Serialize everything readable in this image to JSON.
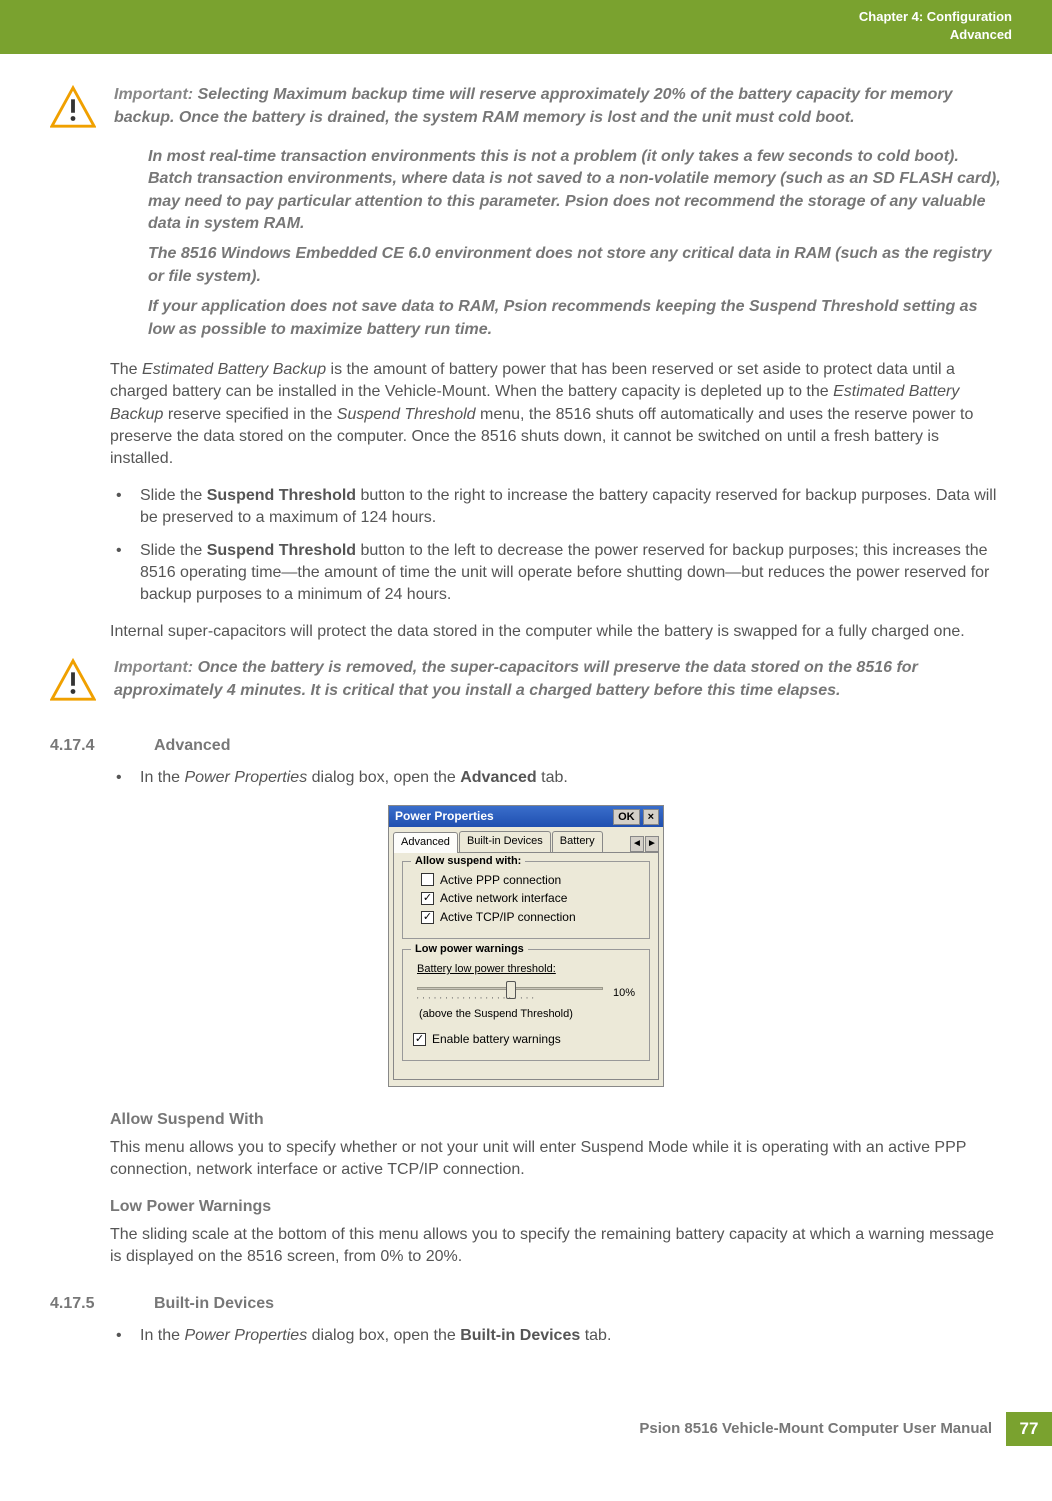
{
  "header": {
    "line1": "Chapter 4: Configuration",
    "line2": "Advanced"
  },
  "imp1": {
    "label": "Important:",
    "p1": "Selecting Maximum backup time will reserve approximately 20% of the battery capacity for memory backup. Once the battery is drained, the system RAM memory is lost and the unit must cold boot.",
    "p2": "In most real-time transaction environments this is not a problem (it only takes a few seconds to cold boot). Batch transaction environments, where data is not saved to a non-volatile memory (such as an SD FLASH card), may need to pay particular attention to this parameter. Psion does not recommend the storage of any valuable data in system RAM.",
    "p3": "The 8516 Windows Embedded CE 6.0 environment does not store any critical data in RAM (such as the registry or file system).",
    "p4": "If your application does not save data to RAM, Psion recommends keeping the Suspend Threshold setting as low as possible to maximize battery run time."
  },
  "para1a": "The ",
  "para1b": "Estimated Battery Backup",
  "para1c": " is the amount of battery power that has been reserved or set aside to protect data until a charged battery can be installed in the Vehicle-Mount. When the battery capacity is depleted up to the ",
  "para1d": "Estimated Battery Backup",
  "para1e": " reserve specified in the ",
  "para1f": "Suspend Threshold",
  "para1g": " menu, the 8516 shuts off automatically and uses the reserve power to preserve the data stored on the computer. Once the 8516 shuts down, it cannot be switched on until a fresh battery is installed.",
  "bul1a": "Slide the ",
  "bul1b": "Suspend Threshold",
  "bul1c": " button to the right to increase the battery capacity reserved for backup purposes. Data will be preserved to a maximum of 124 hours.",
  "bul2a": "Slide the ",
  "bul2b": "Suspend Threshold",
  "bul2c": " button to the left to decrease the power reserved for backup purposes; this increases the 8516 operating time—the amount of time the unit will operate before shutting down—but reduces the power reserved for backup purposes to a minimum of 24 hours.",
  "para2": "Internal super-capacitors will protect the data stored in the computer while the battery is swapped for a fully charged one.",
  "imp2": {
    "label": "Important:",
    "p1": "Once the battery is removed, the super-capacitors will preserve the data stored on the 8516 for approximately 4 minutes. It is critical that you install a charged battery before this time elapses."
  },
  "sec1": {
    "num": "4.17.4",
    "title": "Advanced"
  },
  "advLine_a": "In the ",
  "advLine_b": "Power Properties",
  "advLine_c": " dialog box, open the ",
  "advLine_d": "Advanced",
  "advLine_e": " tab.",
  "dialog": {
    "title": "Power Properties",
    "ok": "OK",
    "close": "×",
    "tabs": {
      "t1": "Advanced",
      "t2": "Built-in Devices",
      "t3": "Battery"
    },
    "g1": {
      "legend": "Allow suspend with:",
      "c1": "Active PPP connection",
      "c2": "Active network interface",
      "c3": "Active TCP/IP connection",
      "c1_checked": false,
      "c2_checked": true,
      "c3_checked": true
    },
    "g2": {
      "legend": "Low power warnings",
      "sliderLabel": "Battery low power threshold:",
      "pct": "10%",
      "note": "(above the Suspend Threshold)",
      "enable": "Enable battery warnings",
      "enable_checked": true
    }
  },
  "sub1": "Allow Suspend With",
  "sub1text": "This menu allows you to specify whether or not your unit will enter Suspend Mode while it is operating with an active PPP connection, network interface or active TCP/IP connection.",
  "sub2": "Low Power Warnings",
  "sub2text": "The sliding scale at the bottom of this menu allows you to specify the remaining battery capacity at which a warning message is displayed on the 8516 screen, from 0% to 20%.",
  "sec2": {
    "num": "4.17.5",
    "title": "Built-in Devices"
  },
  "bidLine_a": "In the ",
  "bidLine_b": "Power Properties",
  "bidLine_c": " dialog box, open the ",
  "bidLine_d": "Built-in Devices",
  "bidLine_e": " tab.",
  "footer": {
    "text": "Psion 8516 Vehicle-Mount Computer User Manual",
    "page": "77"
  }
}
